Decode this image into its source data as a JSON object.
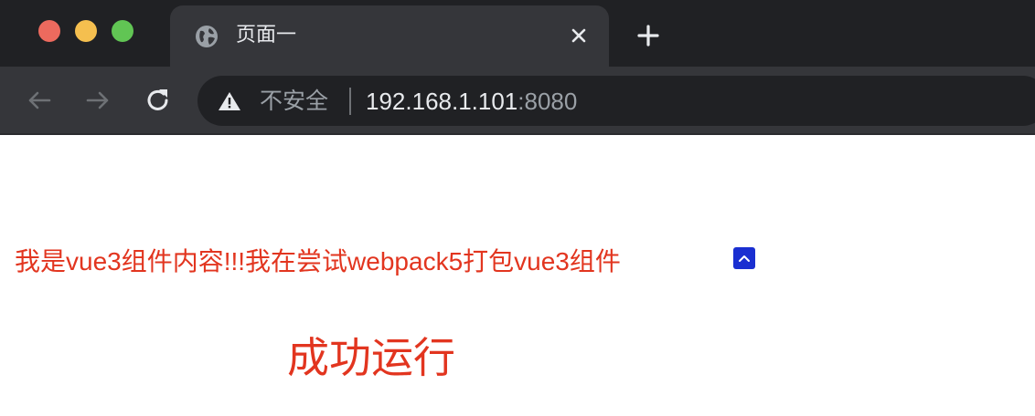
{
  "window": {
    "tab": {
      "title": "页面一"
    },
    "address_bar": {
      "security_label": "不安全",
      "url_host": "192.168.1.101",
      "url_port": ":8080"
    }
  },
  "page": {
    "content_text": "我是vue3组件内容!!!我在尝试webpack5打包vue3组件",
    "heading": "成功运行"
  },
  "icons": {
    "tab_favicon": "globe-icon",
    "tab_close": "close-icon",
    "new_tab": "plus-icon",
    "back": "arrow-left-icon",
    "forward": "arrow-right-icon",
    "reload": "reload-icon",
    "security": "warning-icon",
    "badge": "chevron-up-icon"
  },
  "colors": {
    "chrome_dark": "#202124",
    "chrome_tab": "#35363a",
    "content_text": "#e2351f",
    "badge": "#1a2fd1"
  }
}
